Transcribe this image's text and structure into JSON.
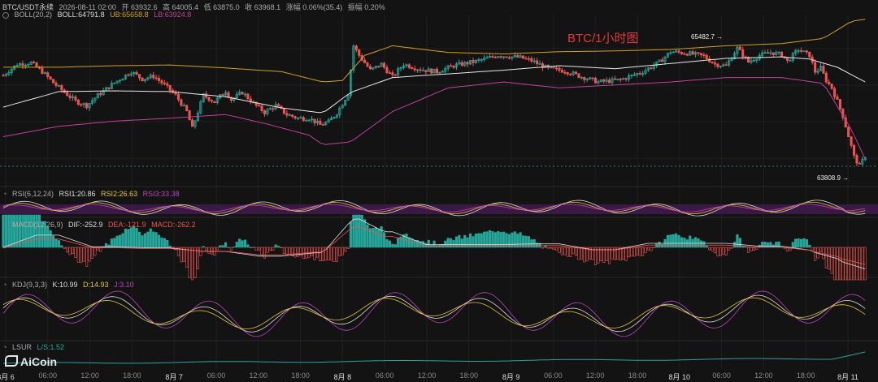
{
  "title": "BTC/1小时图",
  "header": {
    "symbol": "BTC/USDT永续",
    "time": "2026-08-11 02:00",
    "open": "开 63932.6",
    "high": "高 64005.4",
    "low": "低 63875.0",
    "close": "收 63968.1",
    "change": "涨幅 0.06%(35.4)",
    "amplitude": "振幅 0.20%"
  },
  "boll_legend": {
    "name": "BOLL(20,2)",
    "boll": "BOLL:64791.8",
    "ub": "UB:65658.8",
    "lb": "LB:63924.8"
  },
  "rsi_legend": {
    "name": "RSI(6,12,24)",
    "rsi1": "RSI1:20.86",
    "rsi2": "RSI2:26.63",
    "rsi3": "RSI3:33.38"
  },
  "macd_legend": {
    "name": "MACD(12,26,9)",
    "dif": "DIF:-252.9",
    "dea": "DEA:-121.9",
    "macd": "MACD:-262.2"
  },
  "kdj_legend": {
    "name": "KDJ(9,3,3)",
    "k": "K:10.99",
    "d": "D:14.93",
    "j": "J:3.10"
  },
  "lsur_legend": {
    "name": "LSUR",
    "value": "L/S:1.52"
  },
  "callouts": {
    "high": "65482.7",
    "low": "63808.9"
  },
  "logo": "AiCoin",
  "colors": {
    "up": "#26a69a",
    "down": "#ef5350",
    "boll_mid": "#e8e8e8",
    "boll_ub": "#d4a017",
    "boll_lb": "#c040a0",
    "title": "#e23838"
  },
  "chart_data": {
    "type": "candlestick",
    "interval": "1h",
    "x_ticks": [
      "8月 6",
      "06:00",
      "12:00",
      "18:00",
      "8月 7",
      "06:00",
      "12:00",
      "18:00",
      "8月 8",
      "06:00",
      "12:00",
      "18:00",
      "8月 9",
      "06:00",
      "12:00",
      "18:00",
      "8月 10",
      "06:00",
      "12:00",
      "18:00",
      "8月 11"
    ],
    "y_range": [
      63600,
      65850
    ],
    "path": [
      [
        0,
        65050
      ],
      [
        5,
        65200
      ],
      [
        10,
        65220
      ],
      [
        14,
        65100
      ],
      [
        18,
        64950
      ],
      [
        22,
        64820
      ],
      [
        26,
        64700
      ],
      [
        30,
        64640
      ],
      [
        34,
        64780
      ],
      [
        40,
        64950
      ],
      [
        46,
        65100
      ],
      [
        50,
        65000
      ],
      [
        54,
        65040
      ],
      [
        58,
        64920
      ],
      [
        62,
        64780
      ],
      [
        66,
        64560
      ],
      [
        68,
        64330
      ],
      [
        72,
        64780
      ],
      [
        76,
        64690
      ],
      [
        80,
        64840
      ],
      [
        82,
        64720
      ],
      [
        86,
        64820
      ],
      [
        90,
        64670
      ],
      [
        94,
        64550
      ],
      [
        98,
        64640
      ],
      [
        102,
        64520
      ],
      [
        106,
        64470
      ],
      [
        110,
        64470
      ],
      [
        114,
        64380
      ],
      [
        117,
        64420
      ],
      [
        120,
        64540
      ],
      [
        124,
        64800
      ],
      [
        126,
        65450
      ],
      [
        128,
        65320
      ],
      [
        132,
        65120
      ],
      [
        136,
        65200
      ],
      [
        140,
        65030
      ],
      [
        144,
        65200
      ],
      [
        150,
        65130
      ],
      [
        156,
        65100
      ],
      [
        162,
        65180
      ],
      [
        170,
        65240
      ],
      [
        178,
        65320
      ],
      [
        186,
        65290
      ],
      [
        190,
        65250
      ],
      [
        196,
        65140
      ],
      [
        202,
        65110
      ],
      [
        208,
        65030
      ],
      [
        214,
        64960
      ],
      [
        222,
        64990
      ],
      [
        230,
        65100
      ],
      [
        236,
        65230
      ],
      [
        240,
        65370
      ],
      [
        246,
        65350
      ],
      [
        252,
        65310
      ],
      [
        256,
        65200
      ],
      [
        260,
        65180
      ],
      [
        264,
        65420
      ],
      [
        268,
        65230
      ],
      [
        272,
        65320
      ],
      [
        276,
        65360
      ],
      [
        280,
        65330
      ],
      [
        282,
        65240
      ],
      [
        286,
        65400
      ],
      [
        288,
        65360
      ],
      [
        290,
        65320
      ],
      [
        292,
        65100
      ],
      [
        294,
        65150
      ],
      [
        296,
        64980
      ],
      [
        298,
        64880
      ],
      [
        300,
        64700
      ],
      [
        302,
        64500
      ],
      [
        304,
        64230
      ],
      [
        306,
        63950
      ],
      [
        308,
        63820
      ],
      [
        310,
        63960
      ]
    ],
    "boll_ub_path": [
      [
        0,
        65160
      ],
      [
        20,
        65160
      ],
      [
        40,
        65180
      ],
      [
        60,
        65190
      ],
      [
        80,
        65150
      ],
      [
        100,
        65100
      ],
      [
        115,
        64960
      ],
      [
        122,
        64980
      ],
      [
        130,
        65320
      ],
      [
        140,
        65450
      ],
      [
        160,
        65360
      ],
      [
        180,
        65340
      ],
      [
        200,
        65370
      ],
      [
        220,
        65380
      ],
      [
        240,
        65400
      ],
      [
        260,
        65450
      ],
      [
        280,
        65480
      ],
      [
        295,
        65550
      ],
      [
        305,
        65780
      ],
      [
        310,
        65810
      ]
    ],
    "boll_mid_path": [
      [
        0,
        64620
      ],
      [
        20,
        64830
      ],
      [
        40,
        64840
      ],
      [
        60,
        64830
      ],
      [
        80,
        64760
      ],
      [
        100,
        64610
      ],
      [
        115,
        64540
      ],
      [
        125,
        64820
      ],
      [
        140,
        65020
      ],
      [
        160,
        65070
      ],
      [
        180,
        65120
      ],
      [
        200,
        65180
      ],
      [
        220,
        65140
      ],
      [
        240,
        65210
      ],
      [
        260,
        65280
      ],
      [
        280,
        65300
      ],
      [
        290,
        65270
      ],
      [
        300,
        65160
      ],
      [
        310,
        64960
      ]
    ],
    "boll_lb_path": [
      [
        0,
        64220
      ],
      [
        20,
        64360
      ],
      [
        40,
        64430
      ],
      [
        60,
        64470
      ],
      [
        80,
        64520
      ],
      [
        95,
        64390
      ],
      [
        110,
        64240
      ],
      [
        115,
        64110
      ],
      [
        125,
        64150
      ],
      [
        140,
        64560
      ],
      [
        160,
        64880
      ],
      [
        180,
        64960
      ],
      [
        200,
        64880
      ],
      [
        220,
        64920
      ],
      [
        240,
        64960
      ],
      [
        260,
        65020
      ],
      [
        280,
        65020
      ],
      [
        295,
        64940
      ],
      [
        305,
        64320
      ],
      [
        310,
        63920
      ]
    ],
    "rsi_range": [
      0,
      100
    ],
    "rsi_last": {
      "rsi1": 20.86,
      "rsi2": 26.63,
      "rsi3": 33.38
    },
    "macd_last": {
      "dif": -252.9,
      "dea": -121.9,
      "macd": -262.2
    },
    "kdj_last": {
      "k": 10.99,
      "d": 14.93,
      "j": 3.1
    },
    "lsur_last": 1.52
  }
}
